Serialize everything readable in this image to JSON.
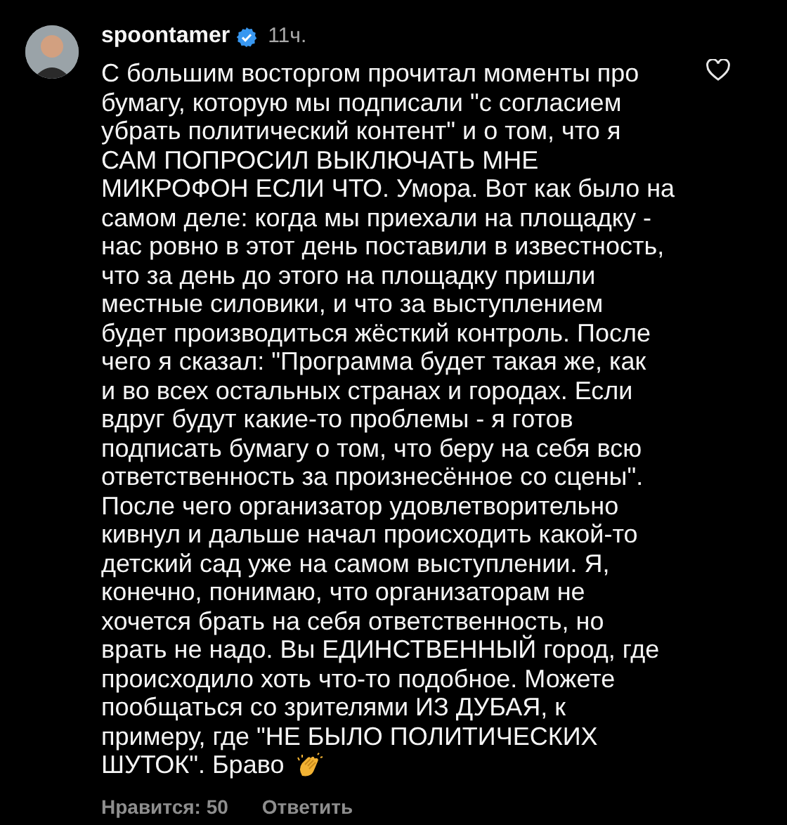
{
  "comment": {
    "username": "spoontamer",
    "verified": true,
    "time": "11ч.",
    "liked": false,
    "lines": [
      "С большим восторгом прочитал моменты про",
      "бумагу, которую мы подписали \"с согласием",
      "убрать политический контент\" и о том, что я",
      "САМ ПОПРОСИЛ ВЫКЛЮЧАТЬ МНЕ",
      "МИКРОФОН ЕСЛИ ЧТО. Умора. Вот как было на",
      "самом деле: когда мы приехали на площадку -",
      "нас ровно в этот день поставили в известность,",
      "что за день до этого на площадку пришли",
      "местные силовики, и что за выступлением",
      "будет производиться жёсткий контроль. После",
      "чего я сказал: \"Программа будет такая же, как",
      "и во всех остальных странах и городах. Если",
      "вдруг будут какие-то проблемы - я готов",
      "подписать бумагу о том, что беру на себя всю",
      "ответственность за произнесённое со сцены\".",
      "После чего организатор удовлетворительно",
      "кивнул и дальше начал происходить какой-то",
      "детский сад уже на самом выступлении. Я,",
      "конечно, понимаю, что организаторам не",
      "хочется брать на себя ответственность, но",
      "врать не надо. Вы ЕДИНСТВЕННЫЙ город, где",
      "происходило хоть что-то подобное. Можете",
      "пообщаться со зрителями ИЗ ДУБАЯ, к",
      "примеру, где \"НЕ БЫЛО ПОЛИТИЧЕСКИХ",
      "ШУТОК\". Браво"
    ],
    "likes": "Нравится: 50",
    "reply": "Ответить"
  }
}
